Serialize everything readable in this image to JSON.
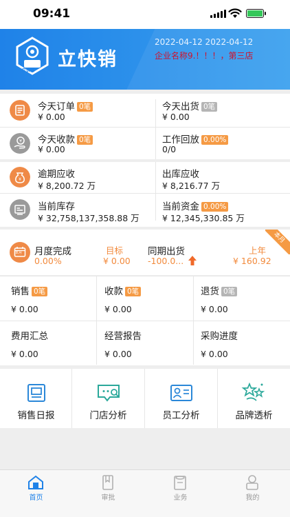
{
  "status_bar": {
    "time": "09:41"
  },
  "header": {
    "logo_text": "立快销",
    "brand": "立快销",
    "dates": "2022-04-12 2022-04-12",
    "company": "企业名称9.！！！，第三店"
  },
  "metrics": [
    {
      "label": "今天订单",
      "badge": "0笔",
      "badge_color": "#f59a44",
      "value": "¥ 0.00",
      "icon": "order-icon"
    },
    {
      "label": "今天出货",
      "badge": "0笔",
      "badge_color": "#b5b5b5",
      "value": "¥ 0.00",
      "icon": null
    },
    {
      "label": "今天收款",
      "badge": "0笔",
      "badge_color": "#f59a44",
      "value": "¥ 0.00",
      "icon": "payment-icon"
    },
    {
      "label": "工作回放",
      "badge": "0.00%",
      "badge_color": "#f59a44",
      "value": "0/0",
      "icon": null
    },
    {
      "label": "逾期应收",
      "badge": "",
      "value": "¥ 8,200.72 万",
      "icon": "overdue-icon"
    },
    {
      "label": "出库应收",
      "badge": "",
      "value": "¥ 8,216.77 万",
      "icon": null
    },
    {
      "label": "当前库存",
      "badge": "",
      "value": "¥ 32,758,137,358.88 万",
      "icon": "inventory-icon"
    },
    {
      "label": "当前资金",
      "badge": "0.00%",
      "badge_color": "#f59a44",
      "value": "¥ 12,345,330.85 万",
      "icon": null
    }
  ],
  "monthly": {
    "title": "月度完成",
    "percent": "0.00%",
    "target_label": "目标",
    "target_value": "¥ 0.00",
    "same_period_label": "同期出货",
    "same_period_value": "-100.0...",
    "last_year_label": "上年",
    "last_year_value": "¥ 160.92",
    "corner_tag": "本月",
    "calendar_text": "本月"
  },
  "stats": [
    {
      "label": "销售",
      "badge": "0笔",
      "badge_color": "#f59a44",
      "value": "¥ 0.00"
    },
    {
      "label": "收款",
      "badge": "0笔",
      "badge_color": "#f59a44",
      "value": "¥ 0.00"
    },
    {
      "label": "退货",
      "badge": "0笔",
      "badge_color": "#b5b5b5",
      "value": "¥ 0.00"
    },
    {
      "label": "费用汇总",
      "badge": "",
      "value": "¥ 0.00"
    },
    {
      "label": "经营报告",
      "badge": "",
      "value": "¥ 0.00"
    },
    {
      "label": "采购进度",
      "badge": "",
      "value": "¥ 0.00"
    }
  ],
  "quick_actions": [
    {
      "label": "销售日报",
      "icon": "sales-daily-icon"
    },
    {
      "label": "门店分析",
      "icon": "store-analysis-icon"
    },
    {
      "label": "员工分析",
      "icon": "employee-analysis-icon"
    },
    {
      "label": "品牌透析",
      "icon": "brand-analysis-icon"
    }
  ],
  "tabs": [
    {
      "label": "首页",
      "icon": "home-icon",
      "active": true
    },
    {
      "label": "审批",
      "icon": "approval-icon",
      "active": false
    },
    {
      "label": "业务",
      "icon": "business-icon",
      "active": false
    },
    {
      "label": "我的",
      "icon": "profile-icon",
      "active": false
    }
  ],
  "colors": {
    "primary": "#1f82e8",
    "accent": "#f28a3c",
    "red": "#d0112b"
  }
}
